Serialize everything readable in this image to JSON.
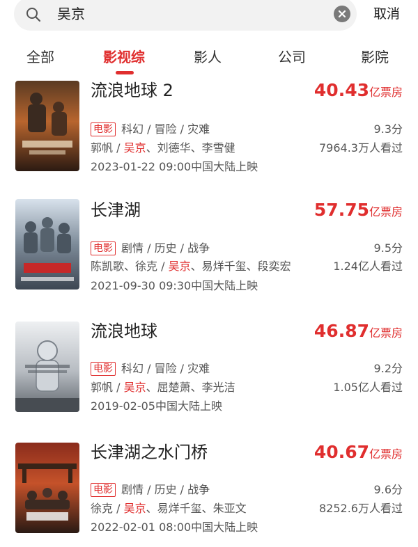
{
  "search": {
    "query": "吴京",
    "cancel_label": "取消"
  },
  "tabs": [
    {
      "label": "全部"
    },
    {
      "label": "影视综"
    },
    {
      "label": "影人"
    },
    {
      "label": "公司"
    },
    {
      "label": "影院"
    }
  ],
  "results": [
    {
      "title": "流浪地球 2",
      "box_value": "40.43",
      "box_unit": "亿票房",
      "tag": "电影",
      "genres": "科幻 / 冒险 / 灾难",
      "score": "9.3分",
      "cast_before": "郭帆 / ",
      "cast_highlight": "吴京",
      "cast_after": "、刘德华、李雪健",
      "viewers": "7964.3万人看过",
      "release": "2023-01-22 09:00中国大陆上映"
    },
    {
      "title": "长津湖",
      "box_value": "57.75",
      "box_unit": "亿票房",
      "tag": "电影",
      "genres": "剧情 / 历史 / 战争",
      "score": "9.5分",
      "cast_before": "陈凯歌、徐克 / ",
      "cast_highlight": "吴京",
      "cast_after": "、易烊千玺、段奕宏",
      "viewers": "1.24亿人看过",
      "release": "2021-09-30 09:30中国大陆上映"
    },
    {
      "title": "流浪地球",
      "box_value": "46.87",
      "box_unit": "亿票房",
      "tag": "电影",
      "genres": "科幻 / 冒险 / 灾难",
      "score": "9.2分",
      "cast_before": "郭帆 / ",
      "cast_highlight": "吴京",
      "cast_after": "、屈楚萧、李光洁",
      "viewers": "1.05亿人看过",
      "release": "2019-02-05中国大陆上映"
    },
    {
      "title": "长津湖之水门桥",
      "box_value": "40.67",
      "box_unit": "亿票房",
      "tag": "电影",
      "genres": "剧情 / 历史 / 战争",
      "score": "9.6分",
      "cast_before": "徐克 / ",
      "cast_highlight": "吴京",
      "cast_after": "、易烊千玺、朱亚文",
      "viewers": "8252.6万人看过",
      "release": "2022-02-01 08:00中国大陆上映"
    }
  ],
  "colors": {
    "accent": "#e02e2e",
    "search_bg": "#f2f2f2"
  }
}
